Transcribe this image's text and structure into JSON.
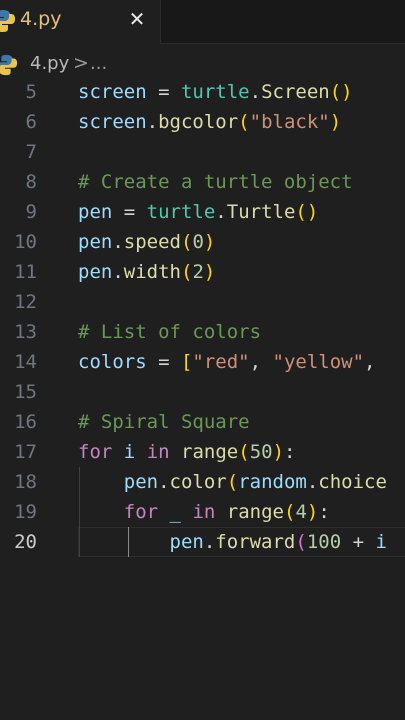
{
  "tab": {
    "label": "4.py",
    "close": "✕"
  },
  "breadcrumb": {
    "file": "4.py",
    "separator": ">",
    "more": "..."
  },
  "colors": {
    "background": "#1f1f1f",
    "tab_label": "#e5c07b",
    "variable": "#9cdcfe",
    "module": "#4ec9b0",
    "function": "#dcdcaa",
    "string": "#ce9178",
    "number": "#b5cea8",
    "comment": "#6a9955",
    "keyword": "#c586c0"
  },
  "icons": {
    "file_type": "python-icon",
    "close": "close-icon"
  },
  "editor": {
    "lines": [
      {
        "n": "5",
        "segs": [
          [
            "screen",
            "var"
          ],
          [
            " = ",
            "op"
          ],
          [
            "turtle",
            "mod"
          ],
          [
            ".",
            "op"
          ],
          [
            "Screen",
            "fn"
          ],
          [
            "()",
            "b1"
          ]
        ]
      },
      {
        "n": "6",
        "segs": [
          [
            "screen",
            "var"
          ],
          [
            ".",
            "op"
          ],
          [
            "bgcolor",
            "fn"
          ],
          [
            "(",
            "b1"
          ],
          [
            "\"black\"",
            "str"
          ],
          [
            ")",
            "b1"
          ]
        ]
      },
      {
        "n": "7",
        "segs": []
      },
      {
        "n": "8",
        "segs": [
          [
            "# Create a turtle object",
            "com"
          ]
        ]
      },
      {
        "n": "9",
        "segs": [
          [
            "pen",
            "var"
          ],
          [
            " = ",
            "op"
          ],
          [
            "turtle",
            "mod"
          ],
          [
            ".",
            "op"
          ],
          [
            "Turtle",
            "fn"
          ],
          [
            "()",
            "b1"
          ]
        ]
      },
      {
        "n": "10",
        "segs": [
          [
            "pen",
            "var"
          ],
          [
            ".",
            "op"
          ],
          [
            "speed",
            "fn"
          ],
          [
            "(",
            "b1"
          ],
          [
            "0",
            "num"
          ],
          [
            ")",
            "b1"
          ]
        ]
      },
      {
        "n": "11",
        "segs": [
          [
            "pen",
            "var"
          ],
          [
            ".",
            "op"
          ],
          [
            "width",
            "fn"
          ],
          [
            "(",
            "b1"
          ],
          [
            "2",
            "num"
          ],
          [
            ")",
            "b1"
          ]
        ]
      },
      {
        "n": "12",
        "segs": []
      },
      {
        "n": "13",
        "segs": [
          [
            "# List of colors",
            "com"
          ]
        ]
      },
      {
        "n": "14",
        "segs": [
          [
            "colors",
            "var"
          ],
          [
            " = ",
            "op"
          ],
          [
            "[",
            "b1"
          ],
          [
            "\"red\"",
            "str"
          ],
          [
            ", ",
            "op"
          ],
          [
            "\"yellow\"",
            "str"
          ],
          [
            ",",
            "op"
          ]
        ]
      },
      {
        "n": "15",
        "segs": []
      },
      {
        "n": "16",
        "segs": [
          [
            "# Spiral Square",
            "com"
          ]
        ]
      },
      {
        "n": "17",
        "segs": [
          [
            "for",
            "kw"
          ],
          [
            " ",
            "op"
          ],
          [
            "i",
            "var"
          ],
          [
            " ",
            "op"
          ],
          [
            "in",
            "kw"
          ],
          [
            " ",
            "op"
          ],
          [
            "range",
            "fn"
          ],
          [
            "(",
            "b1"
          ],
          [
            "50",
            "num"
          ],
          [
            ")",
            "b1"
          ],
          [
            ":",
            "op"
          ]
        ]
      },
      {
        "n": "18",
        "segs": [
          [
            "    ",
            "op"
          ],
          [
            "pen",
            "var"
          ],
          [
            ".",
            "op"
          ],
          [
            "color",
            "fn"
          ],
          [
            "(",
            "b1"
          ],
          [
            "random",
            "var"
          ],
          [
            ".",
            "op"
          ],
          [
            "choice",
            "fn"
          ]
        ]
      },
      {
        "n": "19",
        "segs": [
          [
            "    ",
            "op"
          ],
          [
            "for",
            "kw"
          ],
          [
            " ",
            "op"
          ],
          [
            "_",
            "var"
          ],
          [
            " ",
            "op"
          ],
          [
            "in",
            "kw"
          ],
          [
            " ",
            "op"
          ],
          [
            "range",
            "fn"
          ],
          [
            "(",
            "b1"
          ],
          [
            "4",
            "num"
          ],
          [
            ")",
            "b1"
          ],
          [
            ":",
            "op"
          ]
        ]
      },
      {
        "n": "20",
        "segs": [
          [
            "        ",
            "op"
          ],
          [
            "pen",
            "var"
          ],
          [
            ".",
            "op"
          ],
          [
            "forward",
            "fn"
          ],
          [
            "(",
            "b2"
          ],
          [
            "100",
            "num"
          ],
          [
            " + ",
            "op"
          ],
          [
            "i",
            "var"
          ]
        ]
      }
    ]
  }
}
